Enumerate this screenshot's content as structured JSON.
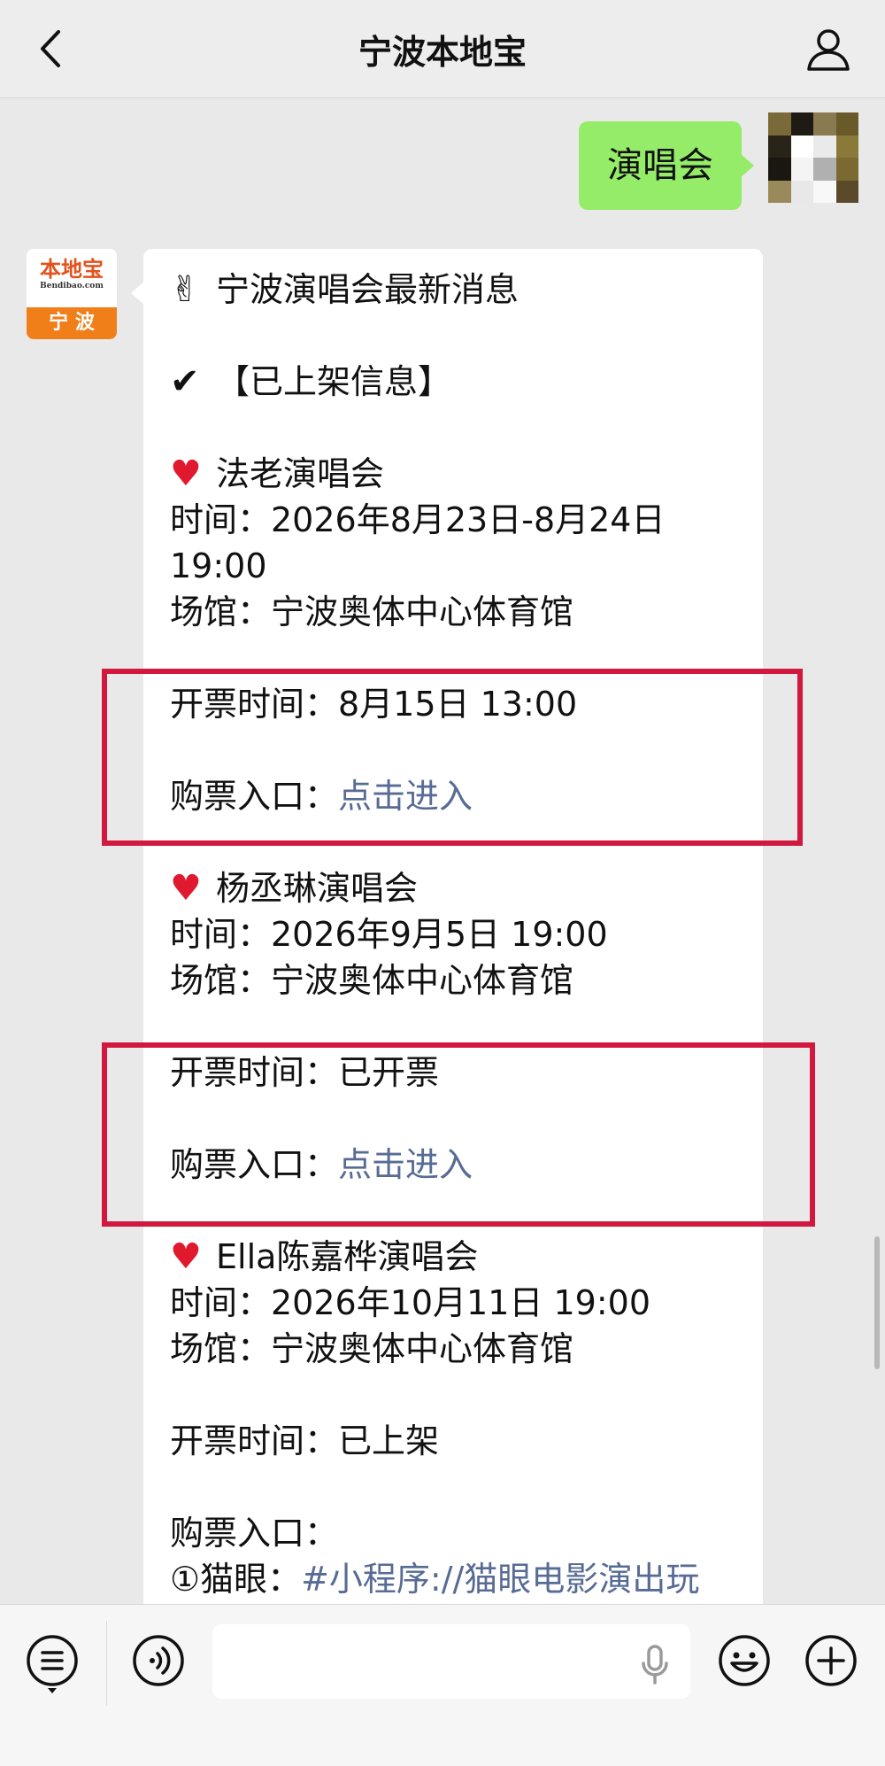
{
  "header": {
    "title": "宁波本地宝"
  },
  "chat": {
    "sent_message": "演唱会",
    "bot_avatar": {
      "brand_text": "本地宝",
      "brand_domain": "Bendibao.com",
      "city_text": "宁 波"
    },
    "reply": {
      "title": "宁波演唱会最新消息",
      "title_emoji": "✌",
      "section_emoji": "✔",
      "section": "【已上架信息】",
      "concerts": [
        {
          "name": "法老演唱会",
          "time": "时间：2026年8月23日-8月24日",
          "time_cont": "19:00",
          "venue": "场馆：宁波奥体中心体育馆",
          "sale": "开票时间：8月15日 13:00",
          "buy_label": "购票入口：",
          "buy_link": "点击进入"
        },
        {
          "name": "杨丞琳演唱会",
          "time": "时间：2026年9月5日 19:00",
          "venue": "场馆：宁波奥体中心体育馆",
          "sale": "开票时间：已开票",
          "buy_label": "购票入口：",
          "buy_link": "点击进入"
        },
        {
          "name": "Ella陈嘉桦演唱会",
          "time": "时间：2026年10月11日 19:00",
          "venue": "场馆：宁波奥体中心体育馆",
          "sale": "开票时间：已上架",
          "buy_label": "购票入口：",
          "buy_option_label": "①猫眼：",
          "buy_option_link": "#小程序://猫眼电影演出玩"
        }
      ]
    }
  },
  "colors": {
    "sent_bubble": "#95ec69",
    "link": "#576b95",
    "highlight_box": "#d1193f",
    "heart": "#e0192e"
  },
  "icons": {
    "back": "chevron-left-icon",
    "profile": "user-icon",
    "menu": "list-icon",
    "voice": "voice-wave-icon",
    "mic": "microphone-icon",
    "emoji": "smiley-icon",
    "add": "plus-circle-icon"
  }
}
